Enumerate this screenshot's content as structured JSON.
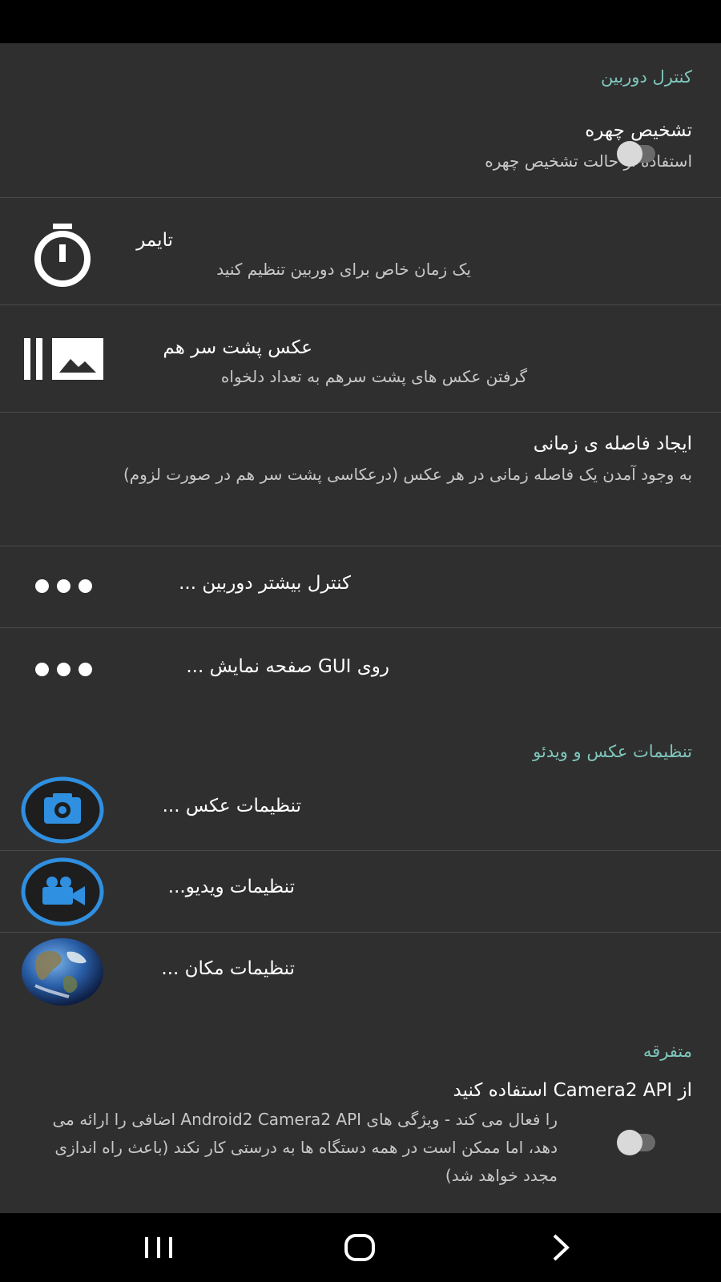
{
  "sections": {
    "camera_controls": "کنترل دوربین",
    "photo_video": "تنظیمات عکس و ویدئو",
    "misc": "متفرقه"
  },
  "items": {
    "face_detection": {
      "title": "تشخیص چهره",
      "summary": "استفاده از حالت تشخیص چهره",
      "enabled": false
    },
    "timer": {
      "title": "تایمر",
      "summary": "یک زمان خاص برای دوربین تنظیم کنید",
      "icon": "timer-icon"
    },
    "burst": {
      "title": "عکس پشت سر هم",
      "summary": "گرفتن عکس های پشت سرهم به تعداد دلخواه",
      "icon": "burst-mode-icon"
    },
    "burst_interval": {
      "title": "ایجاد فاصله ی زمانی",
      "summary": "به وجود آمدن یک فاصله زمانی در هر عکس (درعکاسی پشت سر هم در صورت لزوم)"
    },
    "more_controls": {
      "title": "کنترل بیشتر دوربین ...",
      "icon": "more-dots-icon"
    },
    "gui": {
      "title": "روی GUI صفحه نمایش ...",
      "icon": "more-dots-icon"
    },
    "photo_settings": {
      "title": "تنظیمات عکس ...",
      "icon": "camera-icon"
    },
    "video_settings": {
      "title": "تنظیمات ویدیو...",
      "icon": "video-camera-icon"
    },
    "location_settings": {
      "title": "تنظیمات مکان ...",
      "icon": "globe-icon"
    },
    "camera2": {
      "title": "از Camera2 API استفاده کنید",
      "summary": "را فعال می کند - ویژگی های Android2 Camera2 API اضافی را ارائه می دهد، اما ممکن است در همه دستگاه ها به درستی کار نکند (باعث راه اندازی مجدد خواهد شد)",
      "enabled": false
    }
  },
  "colors": {
    "accent": "#7fc6bb",
    "background": "#2f2f2f",
    "icon_blue": "#2f8fe0"
  },
  "navbar": {
    "icons": [
      "recent-apps-icon",
      "home-icon",
      "back-icon"
    ]
  }
}
